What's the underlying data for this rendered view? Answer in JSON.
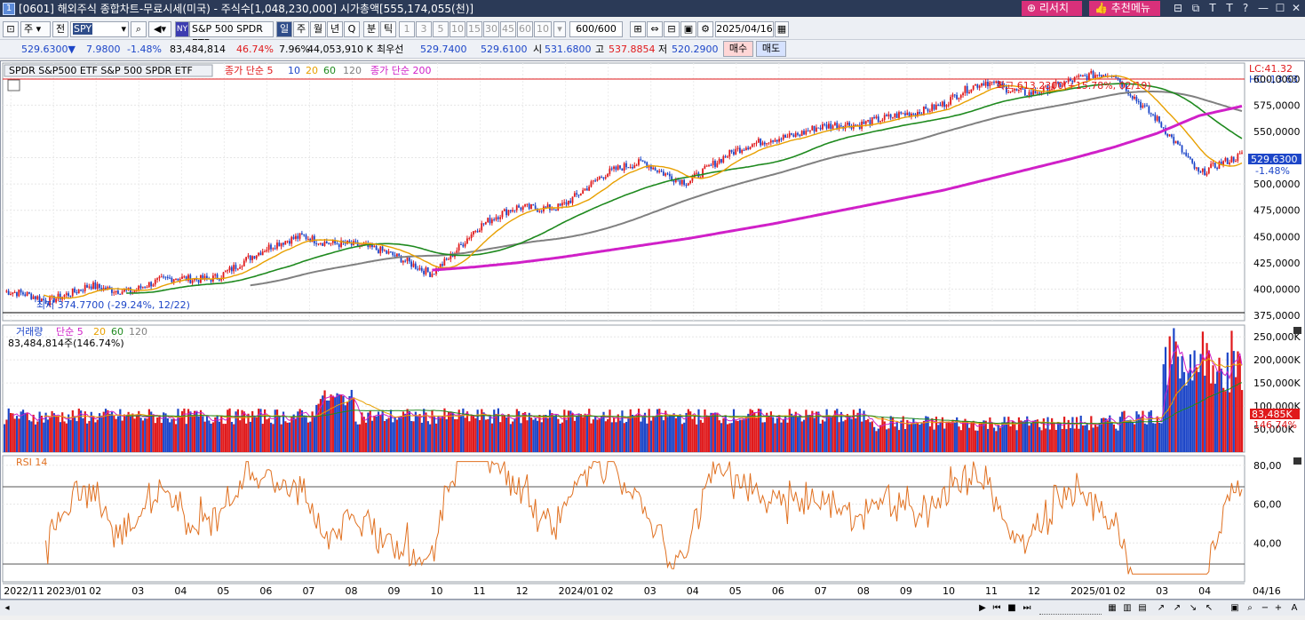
{
  "window": {
    "title": "[0601] 해외주식 종합차트-무료시세(미국) - 주식수[1,048,230,000] 시가총액[555,174,055(천)]",
    "app_num": "1",
    "research_btn": "리서치",
    "recommend_btn": "추천메뉴",
    "controls": [
      "⊟",
      "⧉",
      "T",
      "?",
      "—",
      "☐",
      "✕"
    ]
  },
  "toolbar": {
    "market": "주",
    "prev": "전",
    "symbol": "SPY",
    "exchange_badge": "NY",
    "name": "S&P 500 SPDR ETF",
    "periods": [
      "일",
      "주",
      "월",
      "년",
      "Q"
    ],
    "active_period": "일",
    "min_tick": [
      "분",
      "틱"
    ],
    "intervals": [
      "1",
      "3",
      "5",
      "10",
      "15",
      "30",
      "45",
      "60",
      "10"
    ],
    "count": "600/600",
    "date": "2025/04/16"
  },
  "quote": {
    "price": "529.6300▼",
    "change": "7.9800",
    "change_pct": "-1.48%",
    "volume": "83,484,814",
    "vol_ratio": "46.74%",
    "turnover": "7.96%",
    "amount": "44,053,910 K",
    "best_label": "최우선",
    "bid": "529.7400",
    "ask": "529.6100",
    "open_label": "시",
    "open": "531.6800",
    "high_label": "고",
    "high": "537.8854",
    "low_label": "저",
    "low": "520.2900",
    "buy_btn": "매수",
    "sell_btn": "매도"
  },
  "price_pane": {
    "legend_name": "SPDR S&P500 ETF  S&P 500 SPDR ETF",
    "ma_title": "종가 단순 5",
    "ma_periods": [
      "10",
      "20",
      "60",
      "120"
    ],
    "ma200_label": "종가 단순 200",
    "high_annot": "최고 613.2300(+15.78%, 02/19)",
    "low_annot": "최저 374.7700 (-29.24%, 12/22)",
    "lc": "LC:41.32",
    "hc": "HC:-13.63",
    "cur_price_tag": "529.6300",
    "cur_pct_tag": "-1.48%",
    "y_ticks": [
      "600,0000",
      "575,0000",
      "550,0000",
      "525,0000",
      "500,0000",
      "475,0000",
      "450,0000",
      "425,0000",
      "400,0000",
      "375,0000"
    ]
  },
  "volume_pane": {
    "title": "거래량",
    "ma_title": "단순 5",
    "ma_periods": [
      "20",
      "60",
      "120"
    ],
    "value_label": "83,484,814주(146.74%)",
    "y_ticks": [
      "250,000K",
      "200,000K",
      "150,000K",
      "100,000K",
      "50,000K"
    ],
    "cur_tag": "83,485K",
    "cur_pct_tag": "146.74%"
  },
  "rsi_pane": {
    "title": "RSI 14",
    "y_ticks": [
      "80,00",
      "60,00",
      "40,00"
    ]
  },
  "x_axis": {
    "labels": [
      "2022/11",
      "2023/01",
      "02",
      "03",
      "04",
      "05",
      "06",
      "07",
      "08",
      "09",
      "10",
      "11",
      "12",
      "2024/01",
      "02",
      "03",
      "04",
      "05",
      "06",
      "07",
      "08",
      "09",
      "10",
      "11",
      "12",
      "2025/01",
      "02",
      "03",
      "04"
    ],
    "end_label": "04/16"
  },
  "colors": {
    "up": "#e0191b",
    "down": "#1d46c8",
    "ma5": "#e0191b",
    "ma10": "#1d46c8",
    "ma20": "#e8a000",
    "ma60": "#1f8a1f",
    "ma120": "#808080",
    "ma200": "#d020c8",
    "rsi": "#e07020"
  },
  "chart_data": {
    "type": "line",
    "title": "SPDR S&P500 ETF",
    "xlabel": "",
    "ylabel": "",
    "ylim": [
      370,
      615
    ],
    "x": [
      "2022/11",
      "2023/01",
      "2023/02",
      "2023/03",
      "2023/04",
      "2023/05",
      "2023/06",
      "2023/07",
      "2023/08",
      "2023/09",
      "2023/10",
      "2023/11",
      "2023/12",
      "2024/01",
      "2024/02",
      "2024/03",
      "2024/04",
      "2024/05",
      "2024/06",
      "2024/07",
      "2024/08",
      "2024/09",
      "2024/10",
      "2024/11",
      "2024/12",
      "2025/01",
      "2025/02",
      "2025/03",
      "2025/04",
      "04/16"
    ],
    "series": [
      {
        "name": "SPDR S&P500 ETF",
        "values": [
          398,
          385,
          408,
          395,
          410,
          415,
          432,
          452,
          445,
          430,
          418,
          455,
          475,
          482,
          505,
          520,
          505,
          525,
          545,
          555,
          552,
          570,
          575,
          595,
          590,
          595,
          605,
          565,
          505,
          529.63
        ]
      },
      {
        "name": "종가 단순 200",
        "values": [
          null,
          null,
          null,
          null,
          null,
          null,
          null,
          null,
          null,
          null,
          418,
          421,
          425,
          430,
          436,
          442,
          448,
          455,
          462,
          470,
          478,
          486,
          494,
          504,
          514,
          524,
          535,
          548,
          565,
          574
        ]
      }
    ]
  }
}
